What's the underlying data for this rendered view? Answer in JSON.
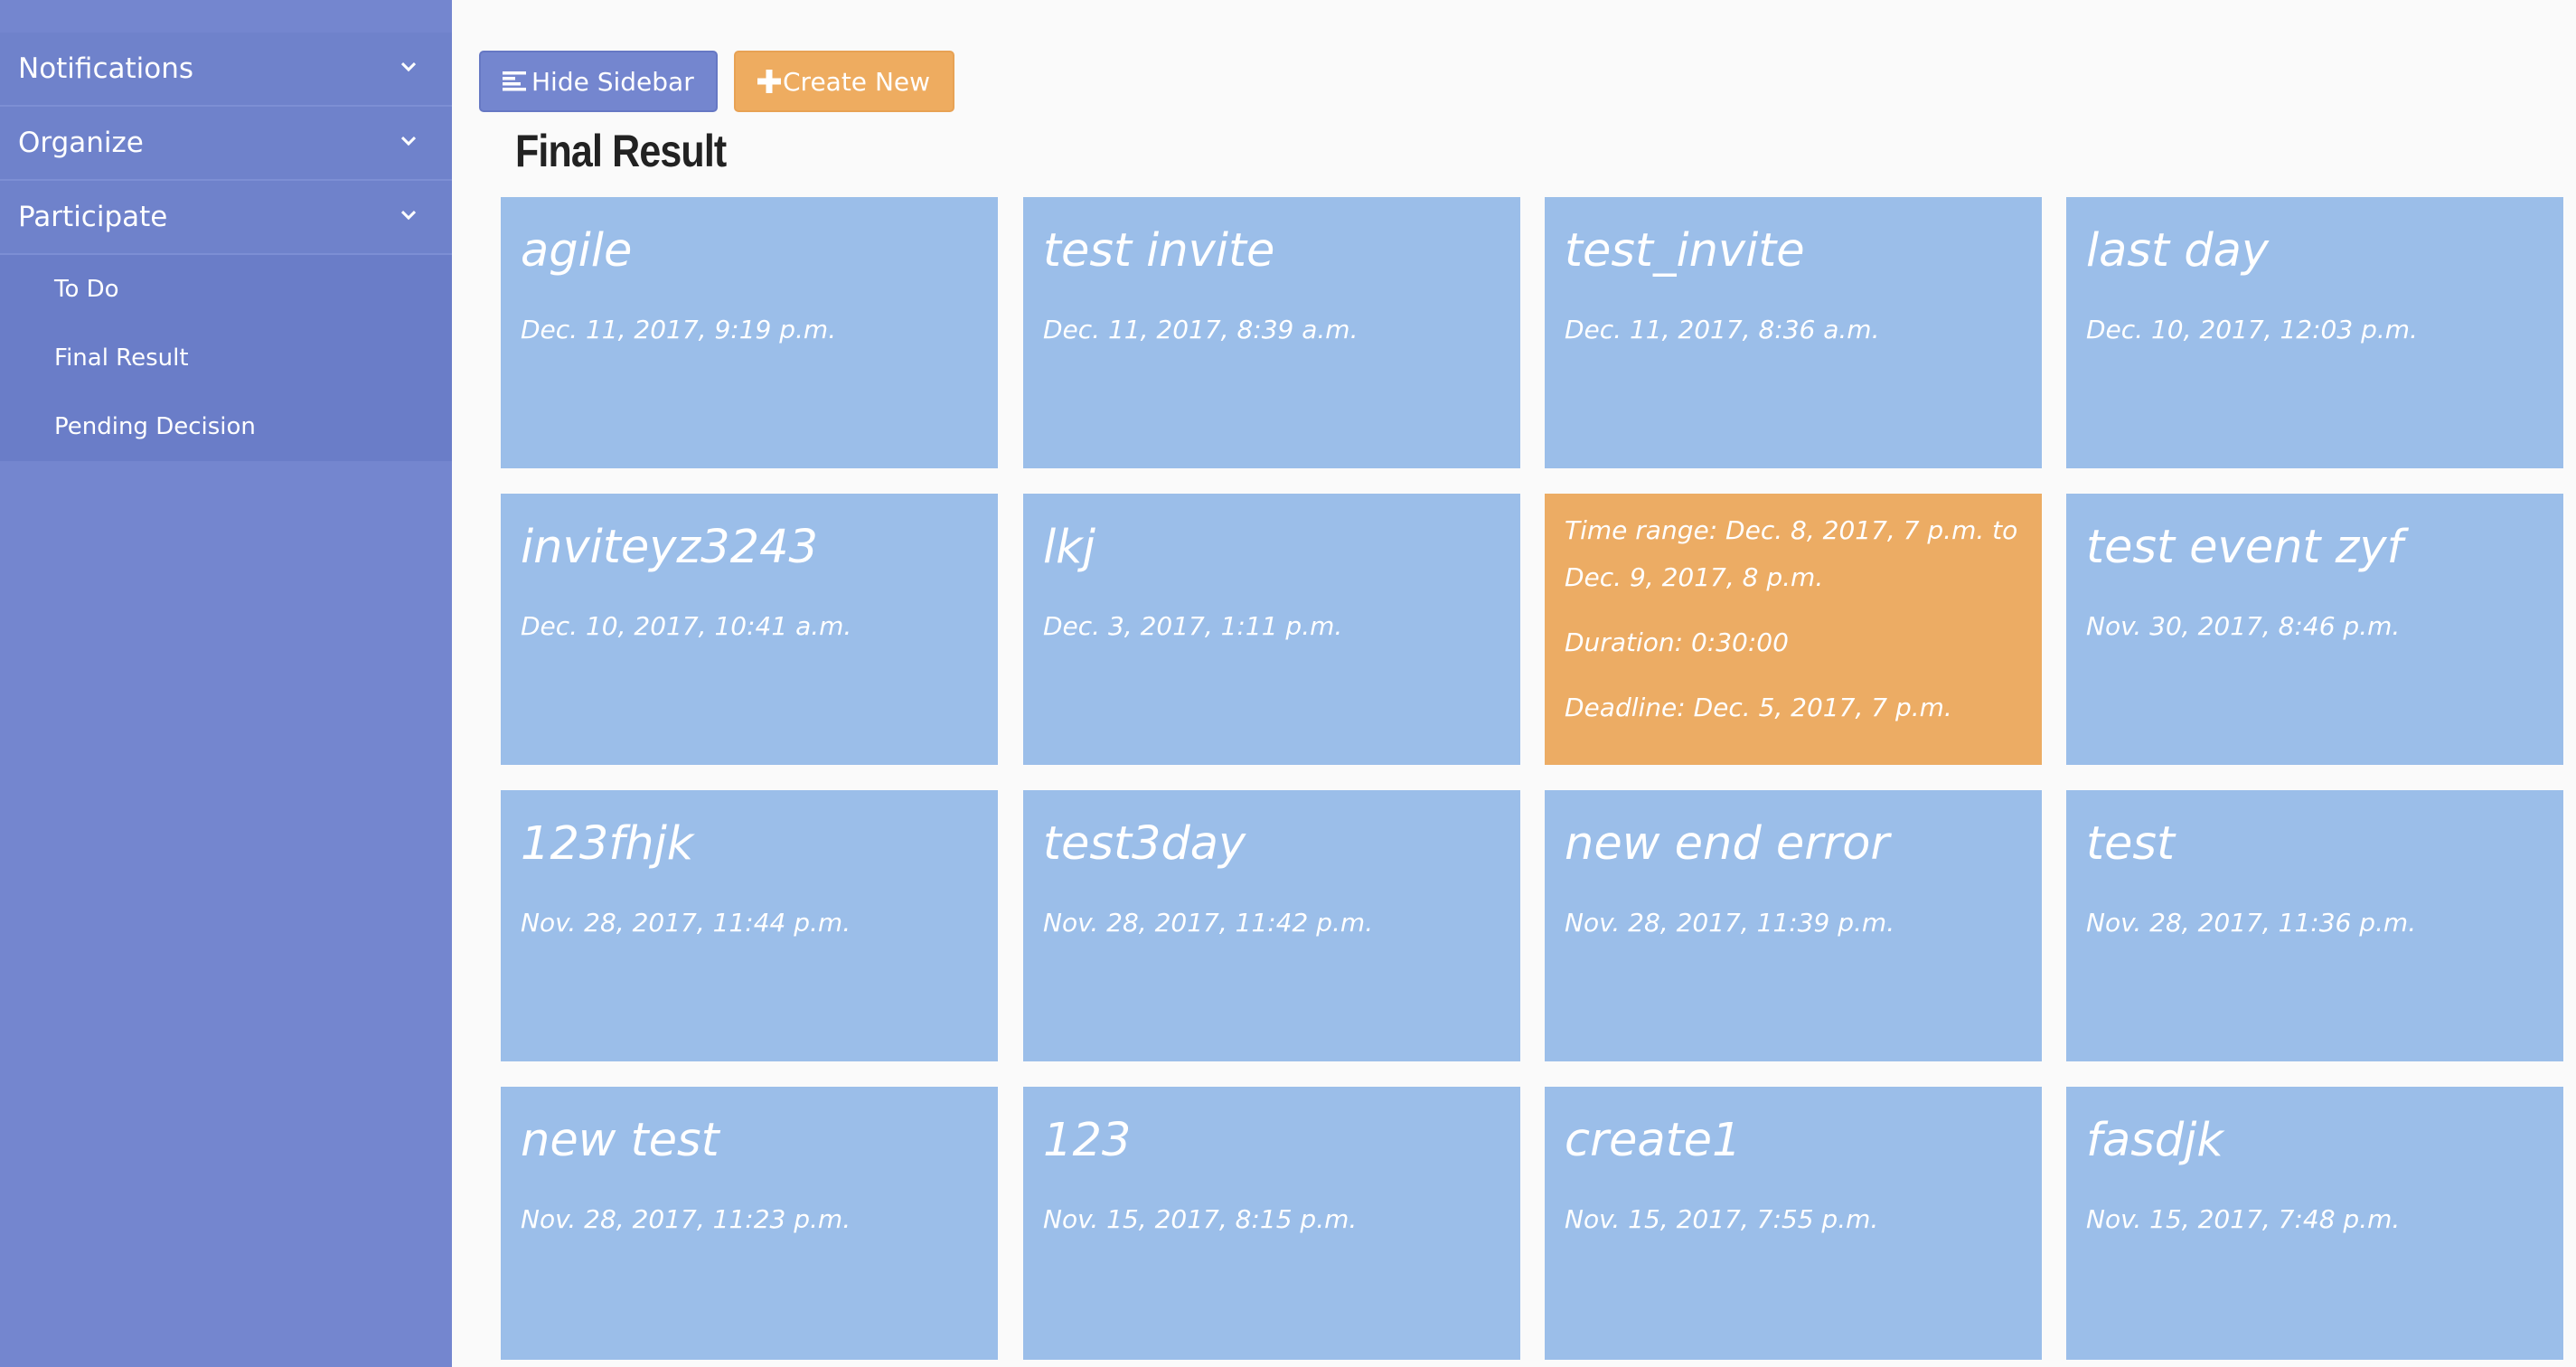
{
  "sidebar": {
    "sections": [
      {
        "label": "Notifications",
        "icon": "chevron-down-icon"
      },
      {
        "label": "Organize",
        "icon": "chevron-down-icon"
      },
      {
        "label": "Participate",
        "icon": "chevron-down-icon"
      }
    ],
    "sub_items": [
      {
        "label": "To Do"
      },
      {
        "label": "Final Result"
      },
      {
        "label": "Pending Decision"
      }
    ]
  },
  "toolbar": {
    "hide_sidebar_label": "Hide Sidebar",
    "create_new_label": "Create New"
  },
  "page": {
    "title": "Final Result"
  },
  "cards": [
    {
      "title": "agile",
      "date": "Dec. 11, 2017, 9:19 p.m."
    },
    {
      "title": "test invite",
      "date": "Dec. 11, 2017, 8:39 a.m."
    },
    {
      "title": "test_invite",
      "date": "Dec. 11, 2017, 8:36 a.m."
    },
    {
      "title": "last day",
      "date": "Dec. 10, 2017, 12:03 p.m."
    },
    {
      "title": "inviteyz3243",
      "date": "Dec. 10, 2017, 10:41 a.m."
    },
    {
      "title": "lkj",
      "date": "Dec. 3, 2017, 1:11 p.m."
    },
    {
      "title": "",
      "date": "",
      "hover": true,
      "time_range_line1": "Time range: Dec. 8, 2017, 7 p.m. to",
      "time_range_line2": "Dec. 9, 2017, 8 p.m.",
      "duration": "Duration: 0:30:00",
      "deadline": "Deadline: Dec. 5, 2017, 7 p.m."
    },
    {
      "title": "test event zyf",
      "date": "Nov. 30, 2017, 8:46 p.m."
    },
    {
      "title": "123fhjk",
      "date": "Nov. 28, 2017, 11:44 p.m."
    },
    {
      "title": "test3day",
      "date": "Nov. 28, 2017, 11:42 p.m."
    },
    {
      "title": "new end error",
      "date": "Nov. 28, 2017, 11:39 p.m."
    },
    {
      "title": "test",
      "date": "Nov. 28, 2017, 11:36 p.m."
    },
    {
      "title": "new test",
      "date": "Nov. 28, 2017, 11:23 p.m."
    },
    {
      "title": "123",
      "date": "Nov. 15, 2017, 8:15 p.m."
    },
    {
      "title": "create1",
      "date": "Nov. 15, 2017, 7:55 p.m."
    },
    {
      "title": "fasdjk",
      "date": "Nov. 15, 2017, 7:48 p.m."
    }
  ],
  "colors": {
    "sidebar": "#7486cf",
    "card": "#9bbee9",
    "card_hover": "#ecac64",
    "create_button": "#eeac60"
  }
}
